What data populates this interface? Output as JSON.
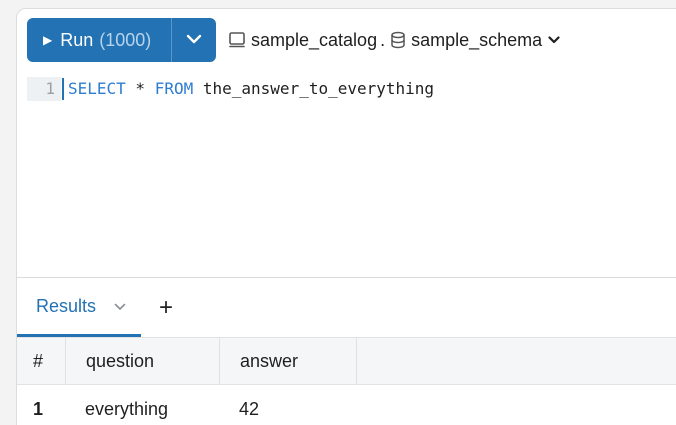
{
  "toolbar": {
    "run_label": "Run",
    "run_limit": "(1000)",
    "catalog": "sample_catalog",
    "separator": ".",
    "schema": "sample_schema"
  },
  "editor": {
    "line_number": "1",
    "tokens": {
      "select": "SELECT",
      "star": " * ",
      "from": "FROM",
      "table": " the_answer_to_everything"
    }
  },
  "results": {
    "tab_label": "Results",
    "add_label": "+",
    "columns": [
      "#",
      "question",
      "answer"
    ],
    "rows": [
      {
        "index": "1",
        "question": "everything",
        "answer": "42"
      }
    ]
  },
  "colors": {
    "accent": "#2272b4",
    "keyword": "#2e7dd1"
  }
}
